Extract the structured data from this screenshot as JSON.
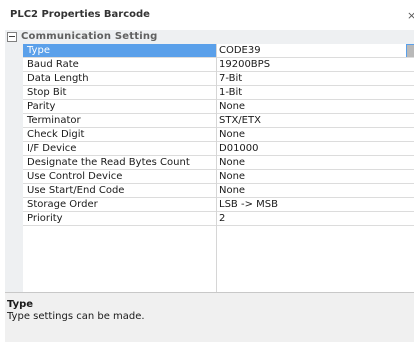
{
  "panel": {
    "title": "PLC2 Properties Barcode",
    "close_glyph": "×"
  },
  "category": {
    "label": "Communication Setting",
    "toggle_icon": "minus-box-icon"
  },
  "properties": [
    {
      "name": "Type",
      "value": "CODE39"
    },
    {
      "name": "Baud Rate",
      "value": "19200BPS"
    },
    {
      "name": "Data Length",
      "value": "7-Bit"
    },
    {
      "name": "Stop Bit",
      "value": "1-Bit"
    },
    {
      "name": "Parity",
      "value": "None"
    },
    {
      "name": "Terminator",
      "value": "STX/ETX"
    },
    {
      "name": "Check Digit",
      "value": "None"
    },
    {
      "name": "I/F Device",
      "value": "D01000"
    },
    {
      "name": "Designate the Read Bytes Count",
      "value": " None"
    },
    {
      "name": "Use Control Device",
      "value": " None"
    },
    {
      "name": "Use Start/End Code",
      "value": " None"
    },
    {
      "name": "Storage Order",
      "value": "LSB -> MSB"
    },
    {
      "name": "Priority",
      "value": "2"
    }
  ],
  "description": {
    "title": "Type",
    "text": "Type settings can be made."
  },
  "colors": {
    "selection": "#5aa0ea",
    "category_bg": "#eef0f2",
    "description_bg": "#f0f0f0"
  }
}
